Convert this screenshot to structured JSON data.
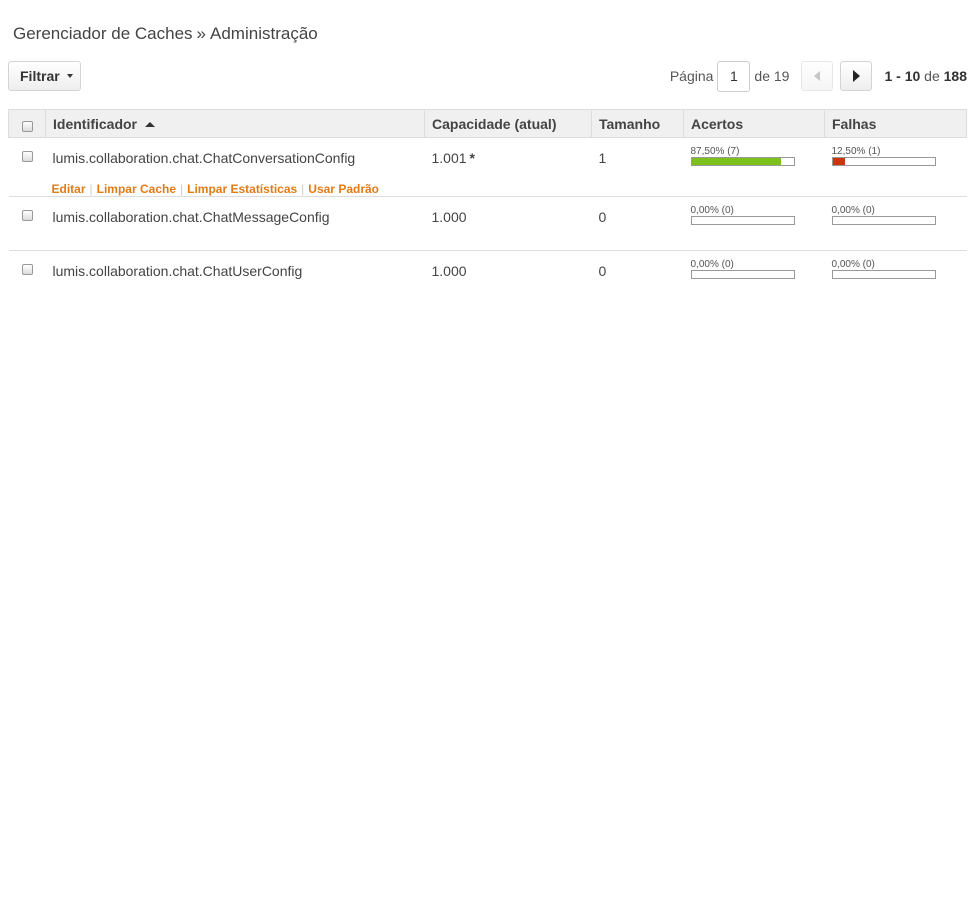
{
  "breadcrumb": {
    "root": "Gerenciador de Caches",
    "separator": "»",
    "current": "Administração"
  },
  "filter": {
    "label": "Filtrar"
  },
  "pager": {
    "page_label": "Página",
    "current_page": "1",
    "of_label": "de 19",
    "range": "1 - 10",
    "range_of": "de",
    "total": "188"
  },
  "table": {
    "headers": {
      "id": "Identificador",
      "capacity": "Capacidade (atual)",
      "size": "Tamanho",
      "hits": "Acertos",
      "misses": "Falhas"
    },
    "rows": [
      {
        "id": "lumis.collaboration.chat.ChatConversationConfig",
        "capacity": "1.001",
        "capacity_flag": "*",
        "size": "1",
        "hits_text": "87,50% (7)",
        "hits_pct": 87.5,
        "misses_text": "12,50% (1)",
        "misses_pct": 12.5,
        "actions": [
          "Editar",
          "Limpar Cache",
          "Limpar Estatísticas",
          "Usar Padrão"
        ]
      },
      {
        "id": "lumis.collaboration.chat.ChatMessageConfig",
        "capacity": "1.000",
        "capacity_flag": "",
        "size": "0",
        "hits_text": "0,00% (0)",
        "hits_pct": 0,
        "misses_text": "0,00% (0)",
        "misses_pct": 0
      },
      {
        "id": "lumis.collaboration.chat.ChatUserConfig",
        "capacity": "1.000",
        "capacity_flag": "",
        "size": "0",
        "hits_text": "0,00% (0)",
        "hits_pct": 0,
        "misses_text": "0,00% (0)",
        "misses_pct": 0
      }
    ]
  },
  "colors": {
    "hits_fill": "#7dc11c",
    "misses_fill": "#c8370f",
    "action_link": "#e27b16"
  },
  "icons": {
    "sort": "sort-ascending-icon",
    "prev": "chevron-left-icon",
    "next": "chevron-right-icon",
    "filter_caret": "caret-down-icon"
  }
}
